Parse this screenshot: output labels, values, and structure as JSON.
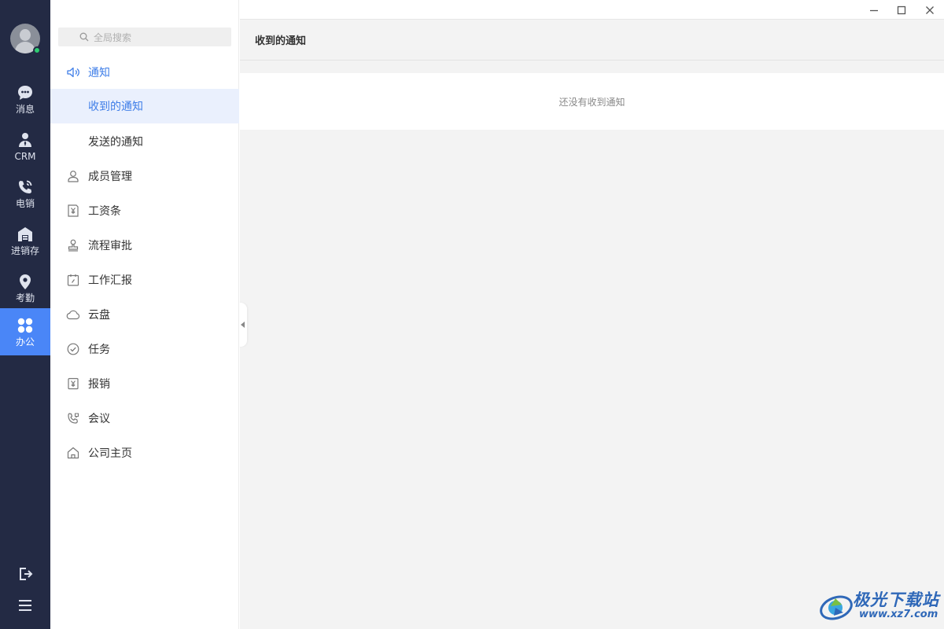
{
  "window": {
    "minimize_icon": "minimize-icon",
    "maximize_icon": "maximize-icon",
    "close_icon": "close-icon"
  },
  "rail": {
    "items": [
      {
        "label": "消息",
        "icon": "chat-bubble-icon"
      },
      {
        "label": "CRM",
        "icon": "person-icon"
      },
      {
        "label": "电销",
        "icon": "phone-icon"
      },
      {
        "label": "进销存",
        "icon": "warehouse-icon"
      },
      {
        "label": "考勤",
        "icon": "location-pin-icon"
      },
      {
        "label": "办公",
        "icon": "grid-icon",
        "active": true
      }
    ],
    "bottom": [
      "logout-icon",
      "menu-icon"
    ],
    "accent": "#4a86f7",
    "background": "#232a44",
    "status_color": "#2ecc71"
  },
  "sidebar": {
    "search_placeholder": "全局搜索",
    "items": [
      {
        "label": "通知",
        "icon": "speaker-icon"
      },
      {
        "label": "收到的通知"
      },
      {
        "label": "发送的通知"
      },
      {
        "label": "成员管理",
        "icon": "user-outline-icon"
      },
      {
        "label": "工资条",
        "icon": "payslip-icon"
      },
      {
        "label": "流程审批",
        "icon": "stamp-icon"
      },
      {
        "label": "工作汇报",
        "icon": "calendar-report-icon"
      },
      {
        "label": "云盘",
        "icon": "cloud-icon"
      },
      {
        "label": "任务",
        "icon": "check-circle-icon"
      },
      {
        "label": "报销",
        "icon": "yen-receipt-icon"
      },
      {
        "label": "会议",
        "icon": "conference-phone-icon"
      },
      {
        "label": "公司主页",
        "icon": "home-icon"
      }
    ]
  },
  "main": {
    "title": "收到的通知",
    "empty_text": "还没有收到通知"
  },
  "watermark": {
    "title": "极光下载站",
    "url": "www.xz7.com"
  }
}
